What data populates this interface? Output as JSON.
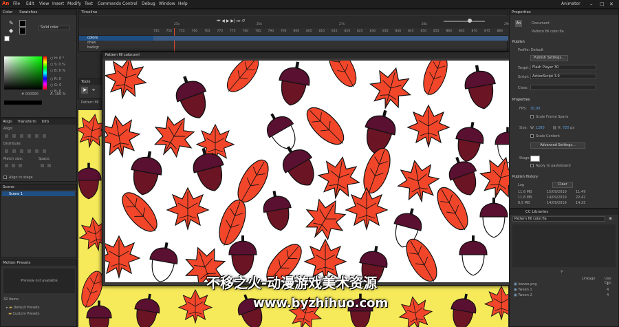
{
  "menubar": {
    "logo": "An",
    "items": [
      "File",
      "Edit",
      "View",
      "Insert",
      "Modify",
      "Text",
      "Commands",
      "Control",
      "Debug",
      "Window",
      "Help"
    ],
    "workspace": "Animator"
  },
  "color_panel": {
    "tabs": [
      "Color",
      "Swatches"
    ],
    "fill_type": "Solid color",
    "hue": {
      "H": "0",
      "S": "0",
      "B": "0"
    },
    "rgb": {
      "R": "0",
      "G": "0",
      "B": "0"
    },
    "hex": "000000",
    "alpha": "100 %"
  },
  "align_panel": {
    "tabs": [
      "Align",
      "Transform",
      "Info"
    ],
    "sections": [
      "Align:",
      "Distribute:",
      "Match size:",
      "Space:"
    ],
    "align_to_stage": "Align to stage"
  },
  "scene_panel": {
    "title": "Scene",
    "scene": "Scene 1"
  },
  "motion_presets": {
    "title": "Motion Presets",
    "preview": "Preview not available",
    "count": "32 items",
    "folders": [
      "Default Presets",
      "Custom Presets"
    ]
  },
  "timeline": {
    "title": "Timeline",
    "layers": [
      "colore",
      "draw",
      "backgr"
    ],
    "frames": [
      "745",
      "750",
      "755",
      "760",
      "765",
      "770",
      "775",
      "780",
      "785",
      "790",
      "795",
      "800",
      "805",
      "810",
      "815",
      "820",
      "825",
      "830",
      "835",
      "840",
      "845",
      "850",
      "855",
      "860",
      "865",
      "870",
      "875",
      "880"
    ],
    "seconds": [
      "25s",
      "26s",
      "27s",
      "28s",
      "29s"
    ]
  },
  "tools": {
    "title": "Tools"
  },
  "document_tab": {
    "name": "Pattern fill color.xml",
    "breadcrumb": "Pattern fill"
  },
  "properties": {
    "title": "Properties",
    "doc_label": "Document",
    "doc_name": "Pattern fill color.fla",
    "publish": "Publish",
    "profile": "Profile: Default",
    "publish_settings": "Publish Settings...",
    "target_label": "Target:",
    "target": "Flash Player 30",
    "script_label": "Script:",
    "script": "ActionScript 3.0",
    "class_label": "Class:",
    "section_props": "Properties",
    "fps_label": "FPS:",
    "fps": "30,00",
    "scale_spans": "Scale Frame Spans",
    "size_label": "Size:",
    "width": "1280",
    "height": "720",
    "unit": "px",
    "scale_content": "Scale Content",
    "advanced": "Advanced Settings...",
    "stage_label": "Stage:",
    "apply_pasteboard": "Apply to pasteboard",
    "history_title": "Publish History",
    "log_label": "Log",
    "clear": "Clear",
    "log": [
      {
        "size": "11,6 MB",
        "date": "15/09/2019",
        "time": "11:49"
      },
      {
        "size": "11,6 MB",
        "date": "14/09/2019",
        "time": "22:42"
      },
      {
        "size": "8,5 MB",
        "date": "14/09/2019",
        "time": "14:25"
      }
    ]
  },
  "library": {
    "tab": "CC Libraries",
    "file": "Pattern fill color.fla",
    "columns": [
      "Linkage",
      "Use Cou"
    ],
    "items": [
      {
        "name": "leaves.png",
        "count": "1"
      },
      {
        "name": "Tween 1",
        "count": "4"
      },
      {
        "name": "Tween 2",
        "count": "4"
      }
    ]
  },
  "watermark": {
    "cn": "不移之火-动漫游戏美术资源",
    "url": "www.byzhihuo.com"
  },
  "colors": {
    "leaf": "#f2462a",
    "acorn": "#6b1424",
    "cap": "#5a1030",
    "stage_bg": "#ffffff",
    "bg_yellow": "#f6ea5a",
    "ui_bg": "#2b2b2b"
  }
}
